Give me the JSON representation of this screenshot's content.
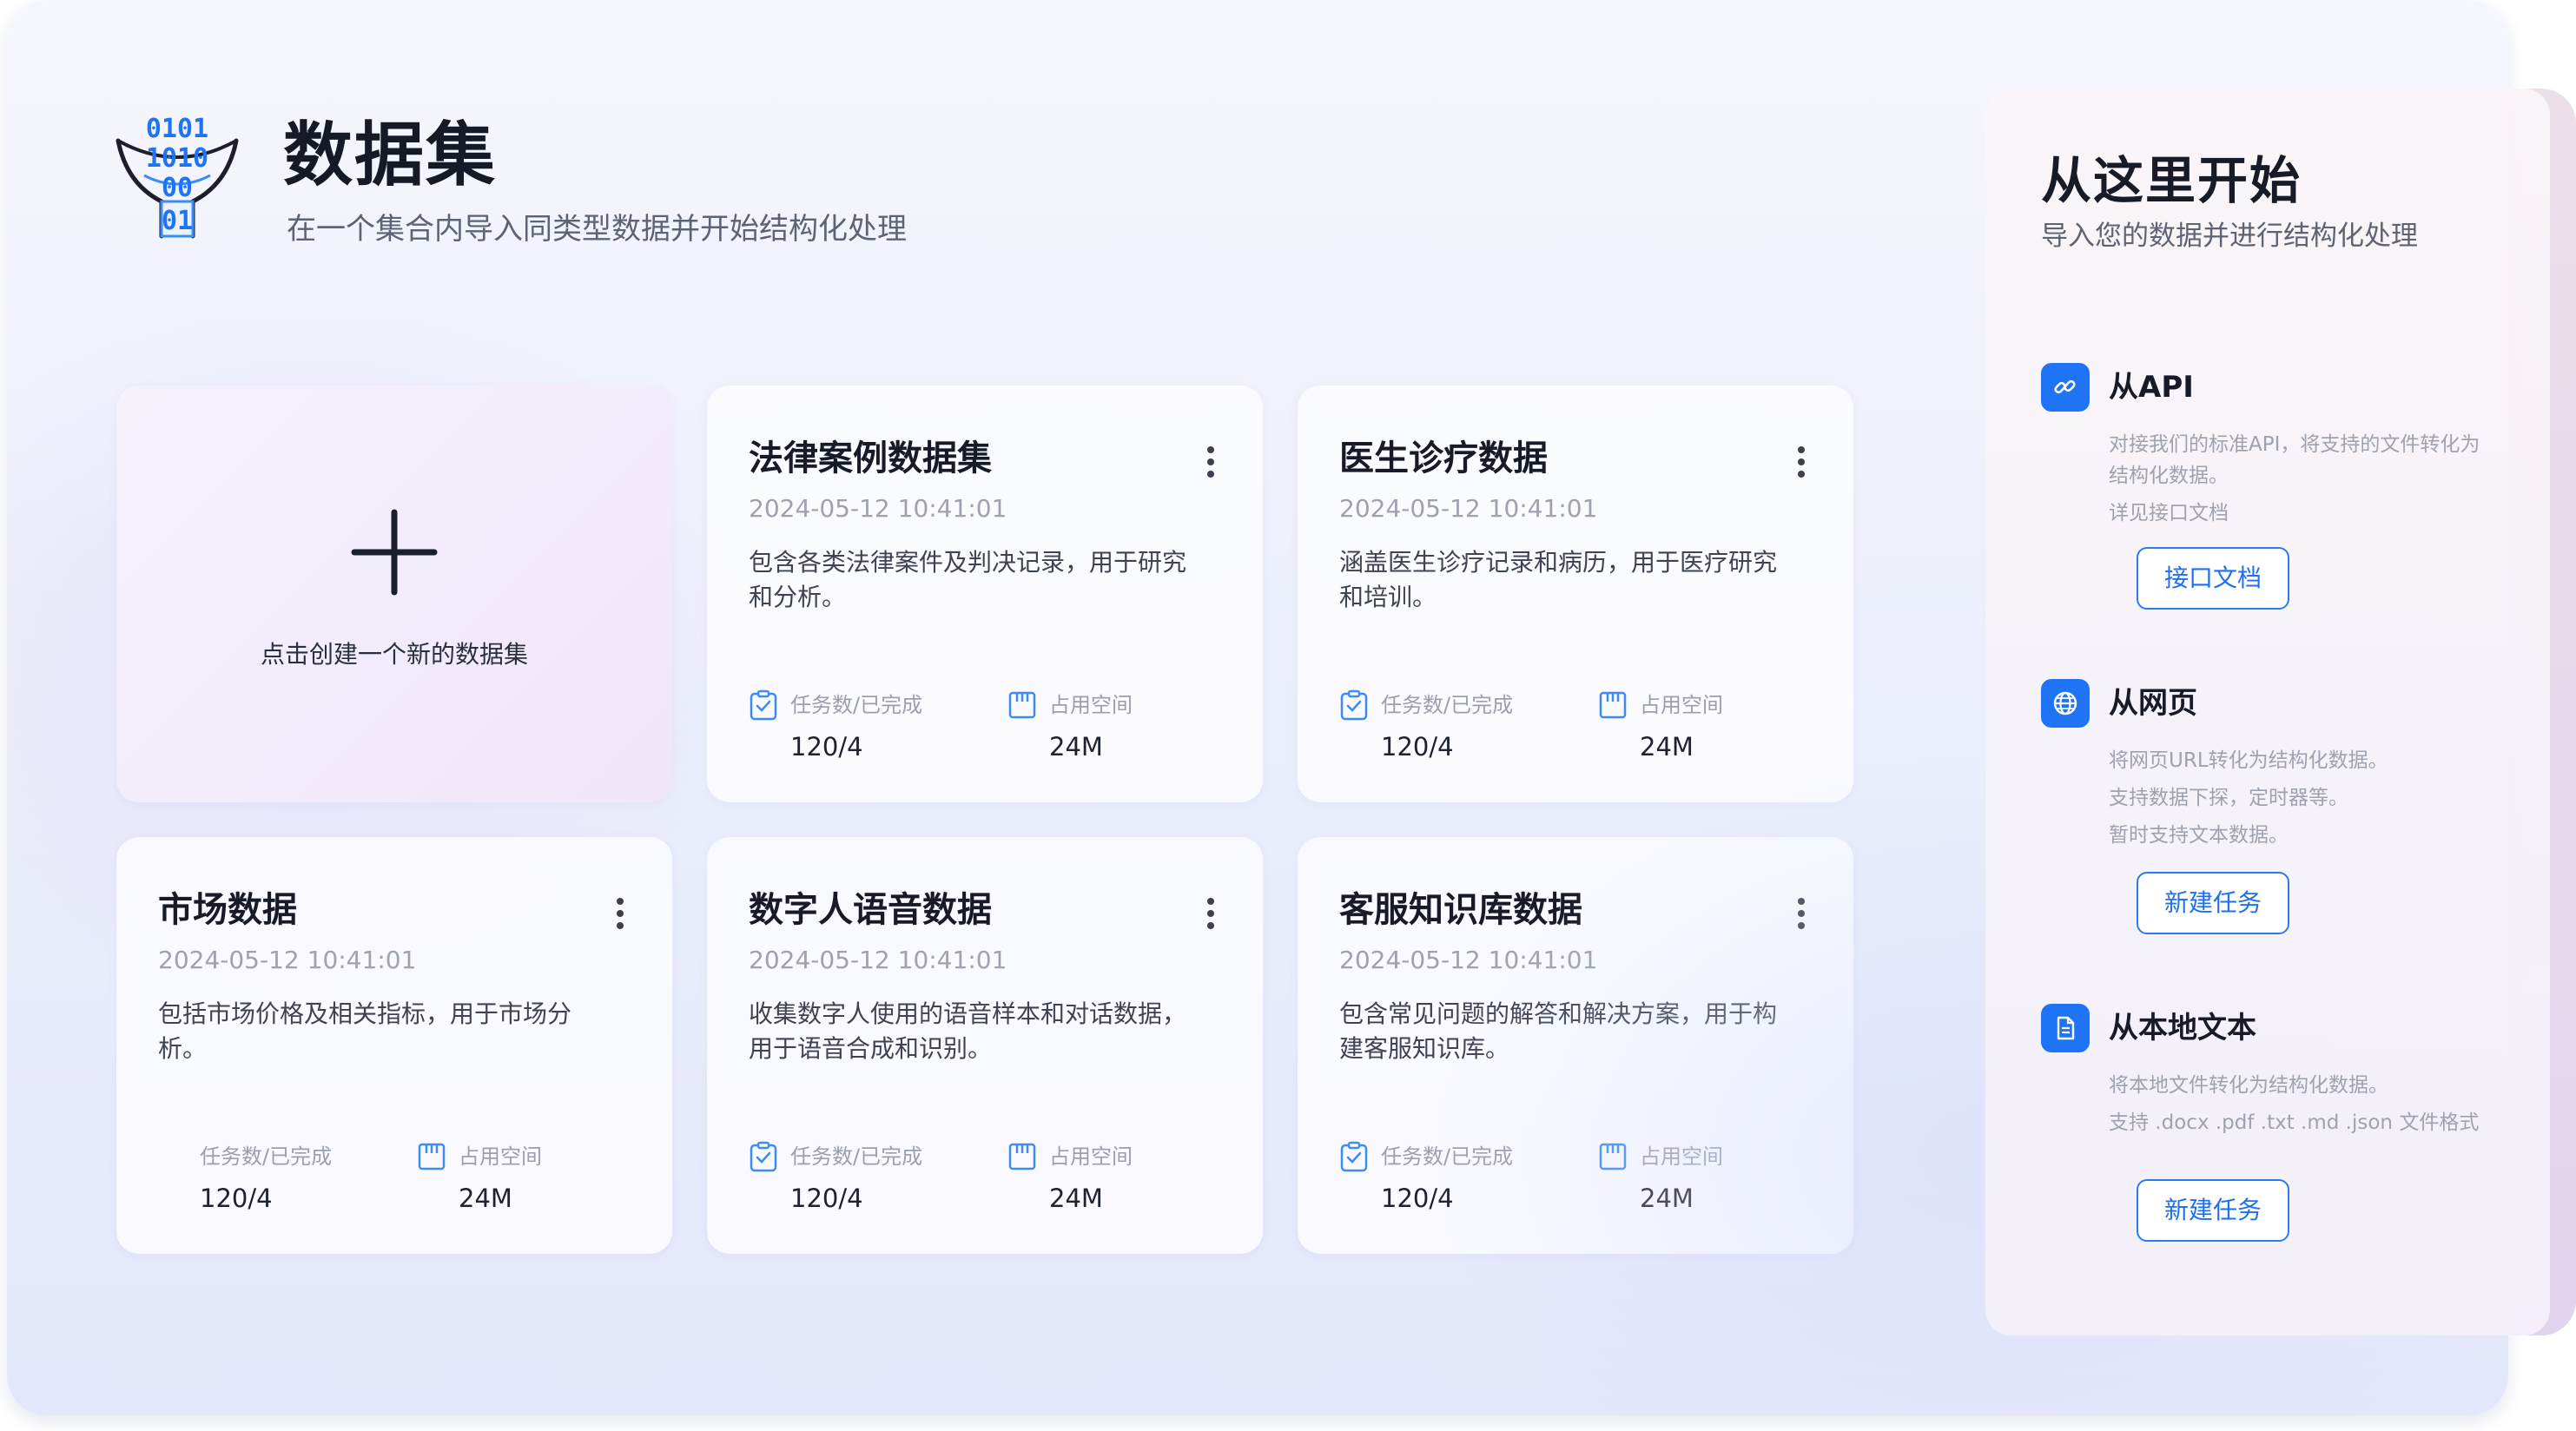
{
  "header": {
    "title": "数据集",
    "subtitle": "在一个集合内导入同类型数据并开始结构化处理",
    "icon": "binary-funnel-icon"
  },
  "new_dataset": {
    "label": "点击创建一个新的数据集",
    "icon": "plus-icon"
  },
  "stats_labels": {
    "tasks": "任务数/已完成",
    "space": "占用空间"
  },
  "datasets": [
    {
      "title": "法律案例数据集",
      "date": "2024-05-12 10:41:01",
      "description": "包含各类法律案件及判决记录，用于研究和分析。",
      "tasks": "120/4",
      "space": "24M"
    },
    {
      "title": "医生诊疗数据",
      "date": "2024-05-12 10:41:01",
      "description": "涵盖医生诊疗记录和病历，用于医疗研究和培训。",
      "tasks": "120/4",
      "space": "24M"
    },
    {
      "title": "市场数据",
      "date": "2024-05-12 10:41:01",
      "description": "包括市场价格及相关指标，用于市场分析。",
      "tasks": "120/4",
      "space": "24M"
    },
    {
      "title": "数字人语音数据",
      "date": "2024-05-12 10:41:01",
      "description": "收集数字人使用的语音样本和对话数据，用于语音合成和识别。",
      "tasks": "120/4",
      "space": "24M"
    },
    {
      "title": "客服知识库数据",
      "date": "2024-05-12 10:41:01",
      "description": "包含常见问题的解答和解决方案，用于构建客服知识库。",
      "tasks": "120/4",
      "space": "24M"
    }
  ],
  "start_panel": {
    "title": "从这里开始",
    "subtitle": "导入您的数据并进行结构化处理",
    "sections": [
      {
        "heading": "从API",
        "icon": "link-icon",
        "lines": [
          "对接我们的标准API，将支持的文件转化为",
          "结构化数据。",
          "详见接口文档"
        ],
        "button": "接口文档"
      },
      {
        "heading": "从网页",
        "icon": "globe-icon",
        "lines": [
          "将网页URL转化为结构化数据。",
          "支持数据下探，定时器等。",
          "暂时支持文本数据。"
        ],
        "button": "新建任务"
      },
      {
        "heading": "从本地文本",
        "icon": "document-icon",
        "lines": [
          "将本地文件转化为结构化数据。",
          "支持 .docx .pdf .txt .md .json 文件格式"
        ],
        "button": "新建任务"
      }
    ]
  },
  "colors": {
    "accent": "#1f74f5",
    "title": "#171b27",
    "muted": "#9ea2af"
  }
}
